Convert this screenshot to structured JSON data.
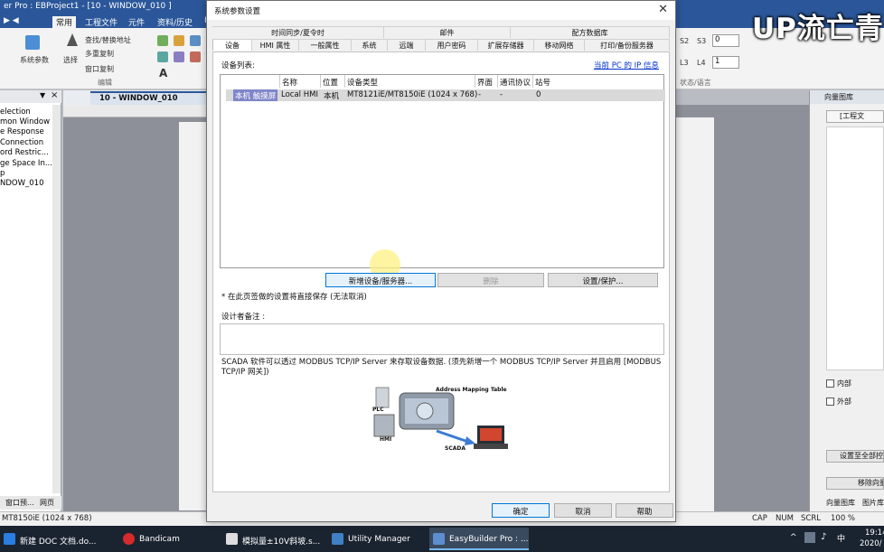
{
  "app": {
    "title": "er Pro : EBProject1 - [10 - WINDOW_010 ]",
    "ribbon_tabs": [
      "常用",
      "工程文件",
      "元件",
      "资料/历史",
      "I"
    ],
    "ribbon": {
      "sys_param": "系统参数",
      "select": "选择",
      "find_replace": "查找/替换地址",
      "multi_copy": "多重复制",
      "window_copy": "窗口复制",
      "edit_group": "编辑",
      "labels_right": [
        "S2",
        "S3",
        "L3",
        "L4"
      ],
      "s3_value": "0",
      "l4_value": "1",
      "state_group": "状态/语言"
    },
    "left_pane": {
      "items": [
        "election",
        "mon Window",
        "e Response",
        "Connection",
        "ord Restric...",
        "ge Space In...",
        "p",
        "NDOW_010"
      ],
      "bottom_tabs": [
        "窗口预...",
        "网页"
      ]
    },
    "doc_tab": "10 - WINDOW_010",
    "right_pane": {
      "title": "向量图库",
      "project_file": "[工程文",
      "check_internal": "内部",
      "check_external": "外部",
      "btn_set_all": "设置至全部控",
      "btn_move": "移除向量",
      "bottom_tabs": [
        "向量图库",
        "图片库"
      ]
    },
    "status": {
      "model": "MT8150iE (1024 x 768)",
      "cap": "CAP",
      "num": "NUM",
      "scrl": "SCRL",
      "zoom": "100 %"
    },
    "taskbar": {
      "items": [
        "新建 DOC 文档.do...",
        "Bandicam",
        "模拟量±10V斜坡.s...",
        "Utility Manager",
        "EasyBuilder Pro : ..."
      ],
      "clock_time": "19:14",
      "clock_date": "2020/"
    },
    "watermark": "UP流亡青"
  },
  "dialog": {
    "title": "系统参数设置",
    "tabs_row1": [
      "时间同步/夏令时",
      "邮件",
      "配方数据库"
    ],
    "tabs_row2": [
      "设备",
      "HMI 属性",
      "一般属性",
      "系统",
      "远端",
      "用户密码",
      "扩展存储器",
      "移动网络",
      "打印/备份服务器"
    ],
    "device_list_label": "设备列表:",
    "ip_info_link": "当前 PC 的 IP 信息",
    "columns": [
      "名称",
      "位置",
      "设备类型",
      "界面",
      "通讯协议",
      "站号"
    ],
    "rows": [
      {
        "kind": "本机 触摸屏",
        "name": "Local HMI",
        "location": "本机",
        "type": "MT8121iE/MT8150iE (1024 x 768)",
        "interface": "-",
        "protocol": "-",
        "station": "0"
      }
    ],
    "buttons": {
      "new_device": "新增设备/服务器...",
      "delete": "删除",
      "settings": "设置/保护..."
    },
    "note_save": "* 在此页签做的设置将直接保存 (无法取消)",
    "designer_note_label": "设计者备注 :",
    "designer_note_value": "",
    "scada_text": "SCADA 软件可以透过 MODBUS TCP/IP Server 来存取设备数据. (须先新增一个 MODBUS TCP/IP Server 并且启用 [MODBUS TCP/IP 网关])",
    "diagram_labels": [
      "Address Mapping Table",
      "PLC",
      "HMI",
      "SCADA"
    ],
    "footer_buttons": [
      "确定",
      "取消",
      "帮助"
    ]
  }
}
